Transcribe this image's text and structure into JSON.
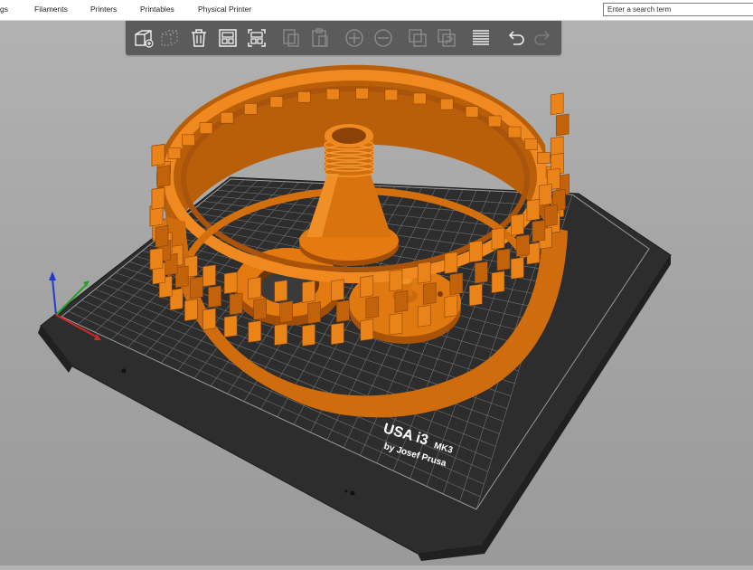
{
  "menubar": {
    "items": [
      "gs",
      "Filaments",
      "Printers",
      "Printables",
      "Physical Printer"
    ]
  },
  "search": {
    "placeholder": "Enter a search term"
  },
  "toolbar": {
    "buttons": [
      {
        "icon": "add-icon",
        "enabled": true
      },
      {
        "icon": "delete-icon",
        "enabled": false
      },
      {
        "icon": "delete-all-icon",
        "enabled": true
      },
      {
        "icon": "arrange-icon",
        "enabled": true
      },
      {
        "icon": "arrange-selection-icon",
        "enabled": true
      },
      {
        "icon": "copy-icon",
        "enabled": false
      },
      {
        "icon": "paste-icon",
        "enabled": false
      },
      {
        "icon": "add-instance-icon",
        "enabled": false
      },
      {
        "icon": "remove-instance-icon",
        "enabled": false
      },
      {
        "icon": "split-objects-icon",
        "enabled": false
      },
      {
        "icon": "split-parts-icon",
        "enabled": false
      },
      {
        "icon": "layers-editing-icon",
        "enabled": true
      },
      {
        "icon": "undo-icon",
        "enabled": true
      },
      {
        "icon": "redo-icon",
        "enabled": false
      }
    ]
  },
  "bed": {
    "logo_line1": "USA i3",
    "logo_line2": "MK3",
    "logo_line3": "by Josef Prusa"
  },
  "colors": {
    "model": "#e2780c",
    "bed": "#2b2b2b",
    "toolbar": "#5b5b5b"
  }
}
